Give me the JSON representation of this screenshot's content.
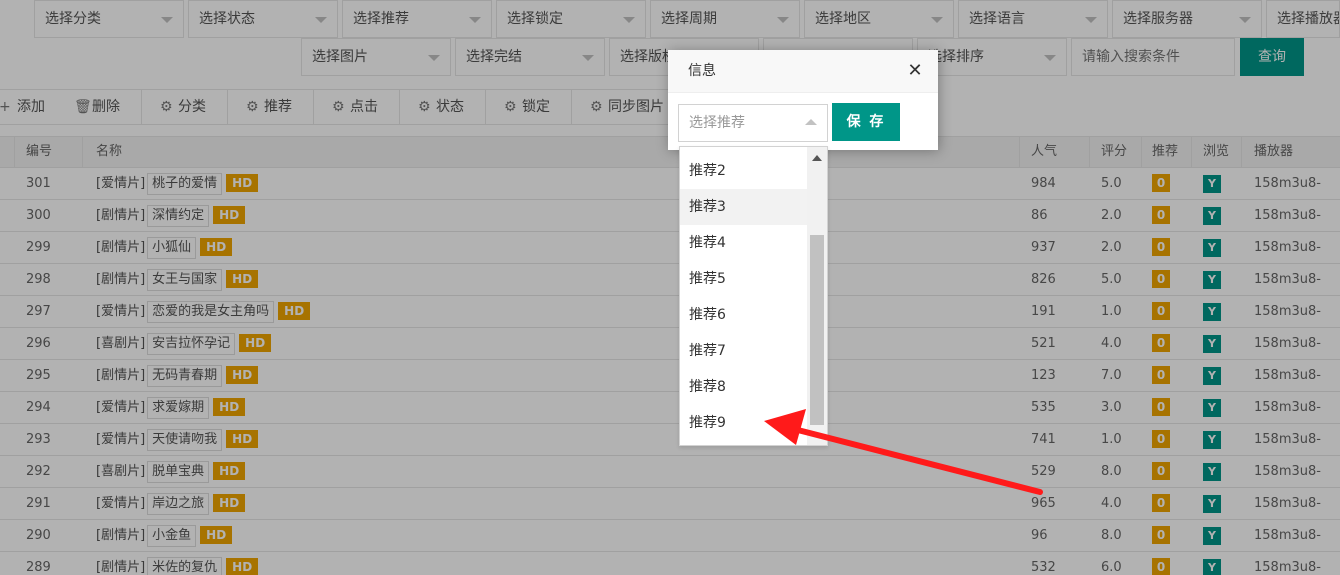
{
  "filters": {
    "row1": [
      "选择分类",
      "选择状态",
      "选择推荐",
      "选择锁定",
      "选择周期",
      "选择地区",
      "选择语言",
      "选择服务器",
      "选择播放器"
    ],
    "row2": [
      "选择图片",
      "选择完结",
      "选择版权",
      "选择排序"
    ],
    "search_placeholder": "请输入搜索条件",
    "query_label": "查询"
  },
  "toolbar": [
    {
      "icon": "plus-icon",
      "glyph": "+",
      "label": "添加"
    },
    {
      "icon": "trash-icon",
      "glyph": "🗑",
      "label": "删除"
    },
    {
      "icon": "gear-icon",
      "glyph": "⚙",
      "label": "分类"
    },
    {
      "icon": "gear-icon",
      "glyph": "⚙",
      "label": "推荐"
    },
    {
      "icon": "gear-icon",
      "glyph": "⚙",
      "label": "点击"
    },
    {
      "icon": "gear-icon",
      "glyph": "⚙",
      "label": "状态"
    },
    {
      "icon": "gear-icon",
      "glyph": "⚙",
      "label": "锁定"
    },
    {
      "icon": "gear-icon",
      "glyph": "⚙",
      "label": "同步图片"
    }
  ],
  "table": {
    "headers": {
      "id": "编号",
      "name": "名称",
      "popularity": "人气",
      "score": "评分",
      "recommend": "推荐",
      "browse": "浏览",
      "player": "播放器"
    },
    "hd_label": "HD",
    "rows": [
      {
        "id": "301",
        "type": "[爱情片]",
        "name": "桃子的爱情",
        "popularity": "984",
        "score": "5.0",
        "recommend": "0",
        "browse": "Y",
        "player": "158m3u8-"
      },
      {
        "id": "300",
        "type": "[剧情片]",
        "name": "深情约定",
        "popularity": "86",
        "score": "2.0",
        "recommend": "0",
        "browse": "Y",
        "player": "158m3u8-"
      },
      {
        "id": "299",
        "type": "[剧情片]",
        "name": "小狐仙",
        "popularity": "937",
        "score": "2.0",
        "recommend": "0",
        "browse": "Y",
        "player": "158m3u8-"
      },
      {
        "id": "298",
        "type": "[剧情片]",
        "name": "女王与国家",
        "popularity": "826",
        "score": "5.0",
        "recommend": "0",
        "browse": "Y",
        "player": "158m3u8-"
      },
      {
        "id": "297",
        "type": "[爱情片]",
        "name": "恋爱的我是女主角吗",
        "popularity": "191",
        "score": "1.0",
        "recommend": "0",
        "browse": "Y",
        "player": "158m3u8-"
      },
      {
        "id": "296",
        "type": "[喜剧片]",
        "name": "安吉拉怀孕记",
        "popularity": "521",
        "score": "4.0",
        "recommend": "0",
        "browse": "Y",
        "player": "158m3u8-"
      },
      {
        "id": "295",
        "type": "[剧情片]",
        "name": "无码青春期",
        "popularity": "123",
        "score": "7.0",
        "recommend": "0",
        "browse": "Y",
        "player": "158m3u8-"
      },
      {
        "id": "294",
        "type": "[爱情片]",
        "name": "求爱嫁期",
        "popularity": "535",
        "score": "3.0",
        "recommend": "0",
        "browse": "Y",
        "player": "158m3u8-"
      },
      {
        "id": "293",
        "type": "[爱情片]",
        "name": "天使请吻我",
        "popularity": "741",
        "score": "1.0",
        "recommend": "0",
        "browse": "Y",
        "player": "158m3u8-"
      },
      {
        "id": "292",
        "type": "[喜剧片]",
        "name": "脱单宝典",
        "popularity": "529",
        "score": "8.0",
        "recommend": "0",
        "browse": "Y",
        "player": "158m3u8-"
      },
      {
        "id": "291",
        "type": "[爱情片]",
        "name": "岸边之旅",
        "popularity": "965",
        "score": "4.0",
        "recommend": "0",
        "browse": "Y",
        "player": "158m3u8-"
      },
      {
        "id": "290",
        "type": "[剧情片]",
        "name": "小金鱼",
        "popularity": "96",
        "score": "8.0",
        "recommend": "0",
        "browse": "Y",
        "player": "158m3u8-"
      },
      {
        "id": "289",
        "type": "[剧情片]",
        "name": "米佐的复仇",
        "popularity": "532",
        "score": "6.0",
        "recommend": "0",
        "browse": "Y",
        "player": "158m3u8-"
      }
    ]
  },
  "dialog": {
    "title": "信息",
    "select_placeholder": "选择推荐",
    "save_label": "保 存",
    "options": [
      "推荐2",
      "推荐3",
      "推荐4",
      "推荐5",
      "推荐6",
      "推荐7",
      "推荐8",
      "推荐9"
    ],
    "hovered_option": "推荐3"
  },
  "colors": {
    "accent": "#009688",
    "badge_orange": "#f0a500",
    "annotation_arrow": "#ff0000"
  }
}
